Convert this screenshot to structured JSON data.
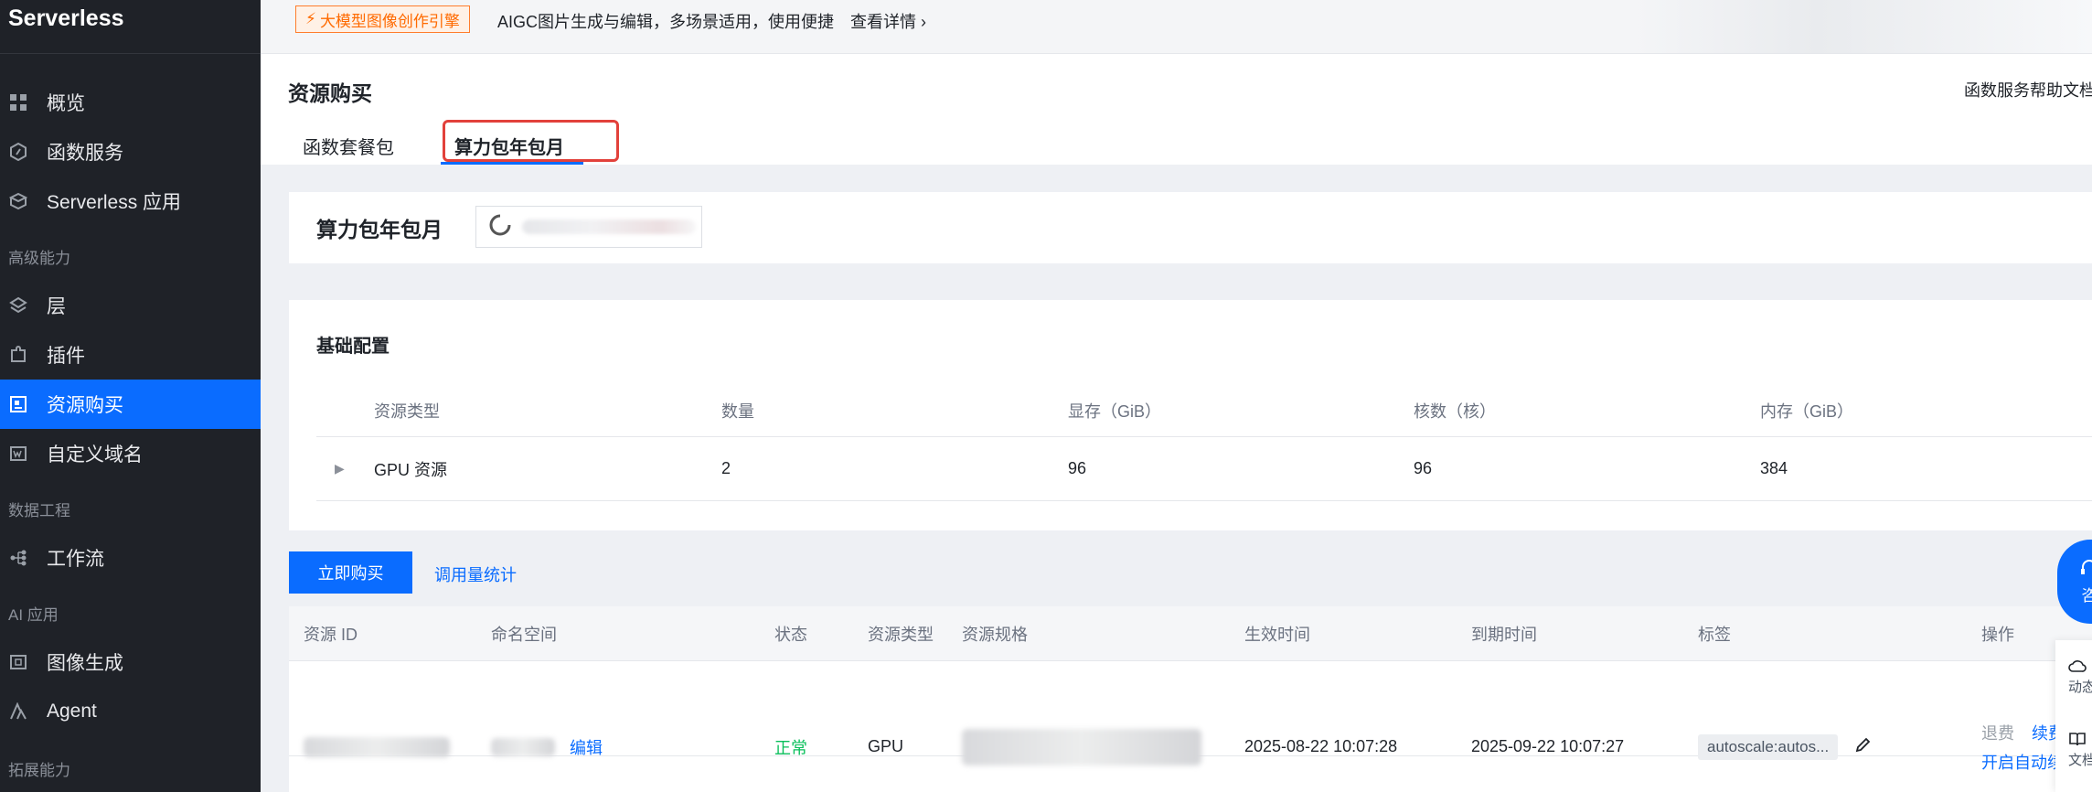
{
  "sidebar": {
    "title": "Serverless",
    "items": [
      {
        "label": "概览",
        "icon": "grid-icon"
      },
      {
        "label": "函数服务",
        "icon": "hexagon-icon"
      },
      {
        "label": "Serverless 应用",
        "icon": "cube-icon"
      },
      {
        "label": "层",
        "icon": "layers-icon"
      },
      {
        "label": "插件",
        "icon": "plugin-icon"
      },
      {
        "label": "资源购买",
        "icon": "resource-icon"
      },
      {
        "label": "自定义域名",
        "icon": "domain-icon"
      },
      {
        "label": "工作流",
        "icon": "workflow-icon"
      },
      {
        "label": "图像生成",
        "icon": "image-icon"
      },
      {
        "label": "Agent",
        "icon": "agent-icon"
      }
    ],
    "sections": [
      "高级能力",
      "数据工程",
      "AI 应用",
      "拓展能力"
    ],
    "active_color": "#0a6cff"
  },
  "banner": {
    "tag": "大模型图像创作引擎",
    "text": "AIGC图片生成与编辑，多场景适用，使用便捷",
    "link": "查看详情"
  },
  "header": {
    "title": "资源购买",
    "help": "函数服务帮助文档",
    "tabs": [
      "函数套餐包",
      "算力包年包月"
    ]
  },
  "package": {
    "title": "算力包年包月"
  },
  "config": {
    "title": "基础配置",
    "columns": [
      "资源类型",
      "数量",
      "显存（GiB）",
      "核数（核）",
      "内存（GiB）"
    ],
    "row": [
      "GPU 资源",
      "2",
      "96",
      "96",
      "384"
    ]
  },
  "actions": {
    "buy": "立即购买",
    "stats": "调用量统计"
  },
  "table": {
    "columns": [
      "资源 ID",
      "命名空间",
      "状态",
      "资源类型",
      "资源规格",
      "生效时间",
      "到期时间",
      "标签",
      "操作"
    ],
    "row": {
      "edit": "编辑",
      "status": "正常",
      "type": "GPU",
      "start": "2025-08-22 10:07:28",
      "end": "2025-09-22 10:07:27",
      "tag": "autoscale:autos...",
      "ops": [
        "退费",
        "续费",
        "开启自动续"
      ]
    }
  },
  "float": {
    "consult": "咨",
    "items": [
      "动态",
      "文档"
    ]
  }
}
